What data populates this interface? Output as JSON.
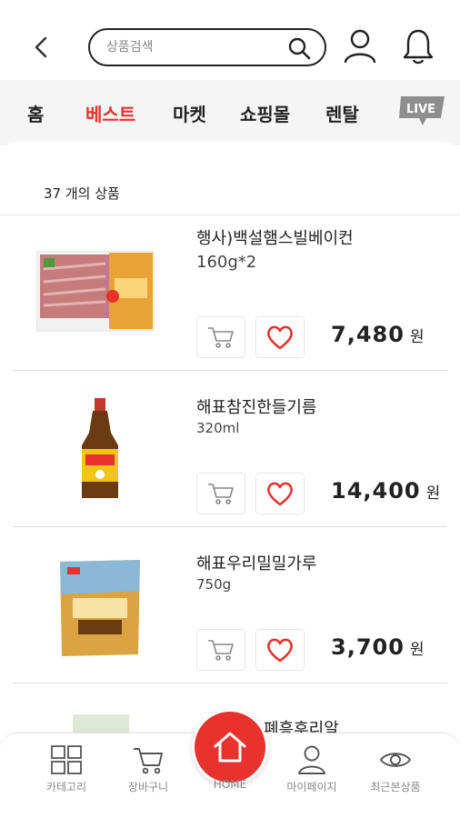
{
  "header": {
    "search_placeholder": "상품검색",
    "icons": [
      "back-arrow-icon",
      "search-icon",
      "user-icon",
      "bell-icon"
    ]
  },
  "tabs": {
    "items": [
      {
        "label": "홈"
      },
      {
        "label": "베스트"
      },
      {
        "label": "마켓"
      },
      {
        "label": "쇼핑몰"
      },
      {
        "label": "렌탈"
      }
    ],
    "active": "베스트",
    "live_badge": "LIVE"
  },
  "colors": {
    "accent": "#e8322d",
    "tab_bg": "#f5f5f5"
  },
  "product_count": "37 개의 상품",
  "products": [
    {
      "name": "행사)백설햄스빌베이컨",
      "desc": "160g*2",
      "price": "7,480",
      "currency": "원"
    },
    {
      "name": "해표참진한들기름",
      "desc": "320ml",
      "price": "14,400",
      "currency": "원"
    },
    {
      "name": "해표우리밀밀가루",
      "desc": "750g",
      "price": "3,700",
      "currency": "원"
    },
    {
      "name": "폐흥후리알"
    }
  ],
  "bottom_nav": {
    "items": [
      {
        "label": "카테고리",
        "icon": "grid-icon"
      },
      {
        "label": "장바구니",
        "icon": "cart-icon"
      },
      {
        "label": "HOME",
        "icon": "home-icon"
      },
      {
        "label": "마이페이지",
        "icon": "user-icon"
      },
      {
        "label": "최근본상품",
        "icon": "eye-icon"
      }
    ]
  }
}
